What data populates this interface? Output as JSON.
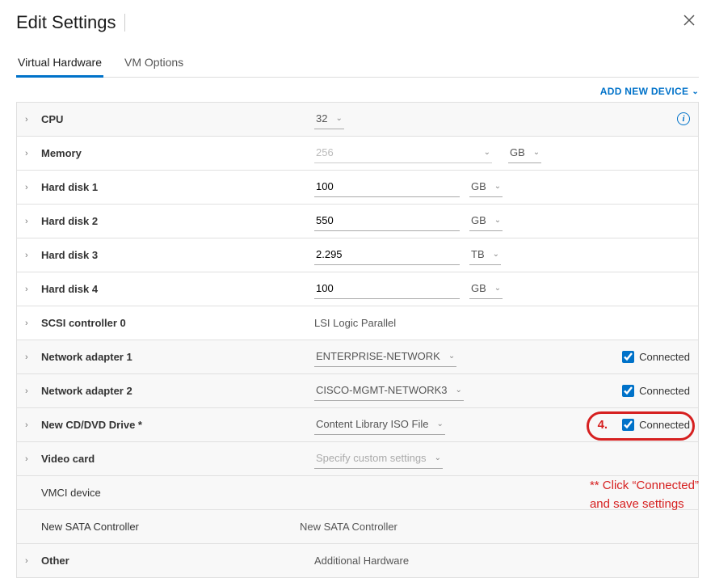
{
  "dialog": {
    "title": "Edit Settings"
  },
  "tabs": {
    "hardware": "Virtual Hardware",
    "options": "VM Options"
  },
  "toolbar": {
    "add_device": "ADD NEW DEVICE"
  },
  "rows": {
    "cpu": {
      "label": "CPU",
      "value": "32"
    },
    "memory": {
      "label": "Memory",
      "value": "256",
      "unit": "GB"
    },
    "hd1": {
      "label": "Hard disk 1",
      "value": "100",
      "unit": "GB"
    },
    "hd2": {
      "label": "Hard disk 2",
      "value": "550",
      "unit": "GB"
    },
    "hd3": {
      "label": "Hard disk 3",
      "value": "2.295",
      "unit": "TB"
    },
    "hd4": {
      "label": "Hard disk 4",
      "value": "100",
      "unit": "GB"
    },
    "scsi": {
      "label": "SCSI controller 0",
      "value": "LSI Logic Parallel"
    },
    "net1": {
      "label": "Network adapter 1",
      "value": "ENTERPRISE-NETWORK",
      "connected": "Connected"
    },
    "net2": {
      "label": "Network adapter 2",
      "value": "CISCO-MGMT-NETWORK3",
      "connected": "Connected"
    },
    "cd": {
      "label": "New CD/DVD Drive *",
      "value": "Content Library ISO File",
      "connected": "Connected"
    },
    "video": {
      "label": "Video card",
      "value": "Specify custom settings"
    },
    "vmci": {
      "label": "VMCI device"
    },
    "sata": {
      "label": "New SATA Controller",
      "value": "New SATA Controller"
    },
    "other": {
      "label": "Other",
      "value": "Additional Hardware"
    }
  },
  "annotations": {
    "step_number": "4.",
    "note": "** Click “Connected”\nand save settings"
  }
}
